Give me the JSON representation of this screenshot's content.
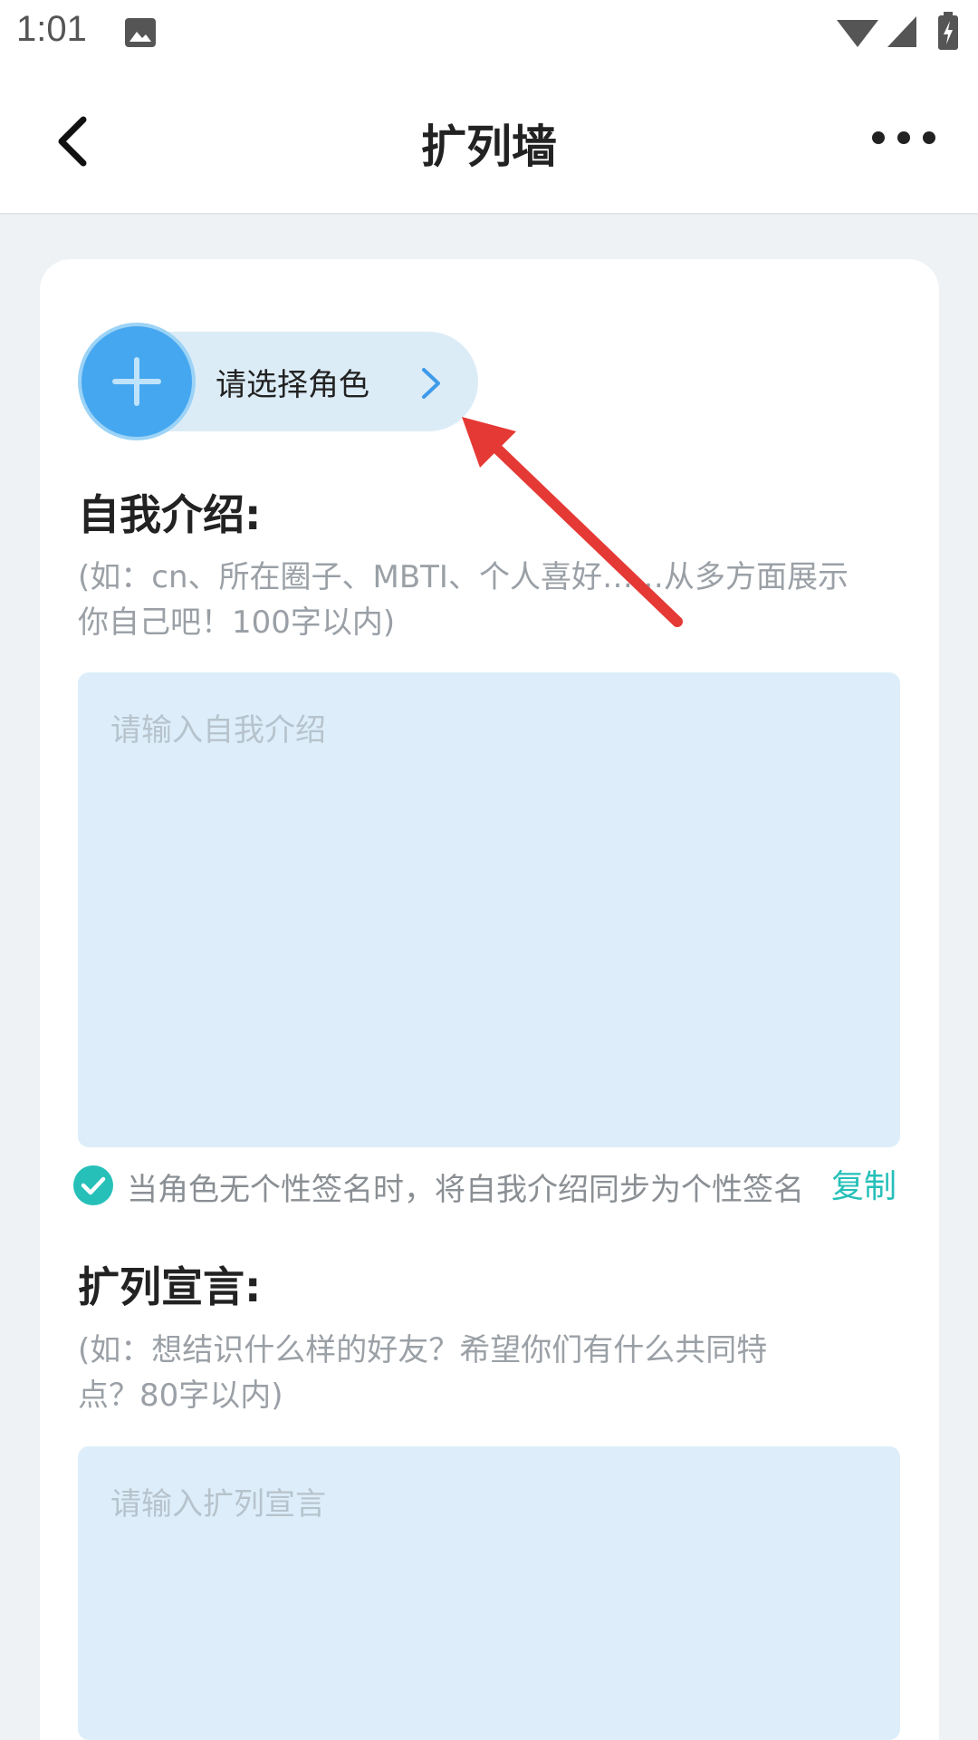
{
  "status": {
    "time": "1:01"
  },
  "header": {
    "title": "扩列墙"
  },
  "role": {
    "label": "请选择角色"
  },
  "intro": {
    "title": "自我介绍:",
    "hint_line1": "(如：cn、所在圈子、MBTI、个人喜好……从多方面展示",
    "hint_line2": "你自己吧！100字以内)",
    "placeholder": "请输入自我介绍"
  },
  "sync": {
    "label": "当角色无个性签名时，将自我介绍同步为个性签名",
    "copy": "复制"
  },
  "declaration": {
    "title": "扩列宣言:",
    "hint_line1": "(如：想结识什么样的好友？希望你们有什么共同特",
    "hint_line2": "点？80字以内)",
    "placeholder": "请输入扩列宣言"
  },
  "colors": {
    "accent_blue": "#45a7f0",
    "accent_teal": "#26c0b9",
    "input_bg": "#ddeefa",
    "annotation_red": "#e53935"
  },
  "icons": [
    "image-icon",
    "wifi-icon",
    "signal-icon",
    "battery-charging-icon",
    "back-arrow-icon",
    "more-icon",
    "plus-icon",
    "chevron-right-icon",
    "check-circle-icon",
    "annotation-arrow"
  ]
}
